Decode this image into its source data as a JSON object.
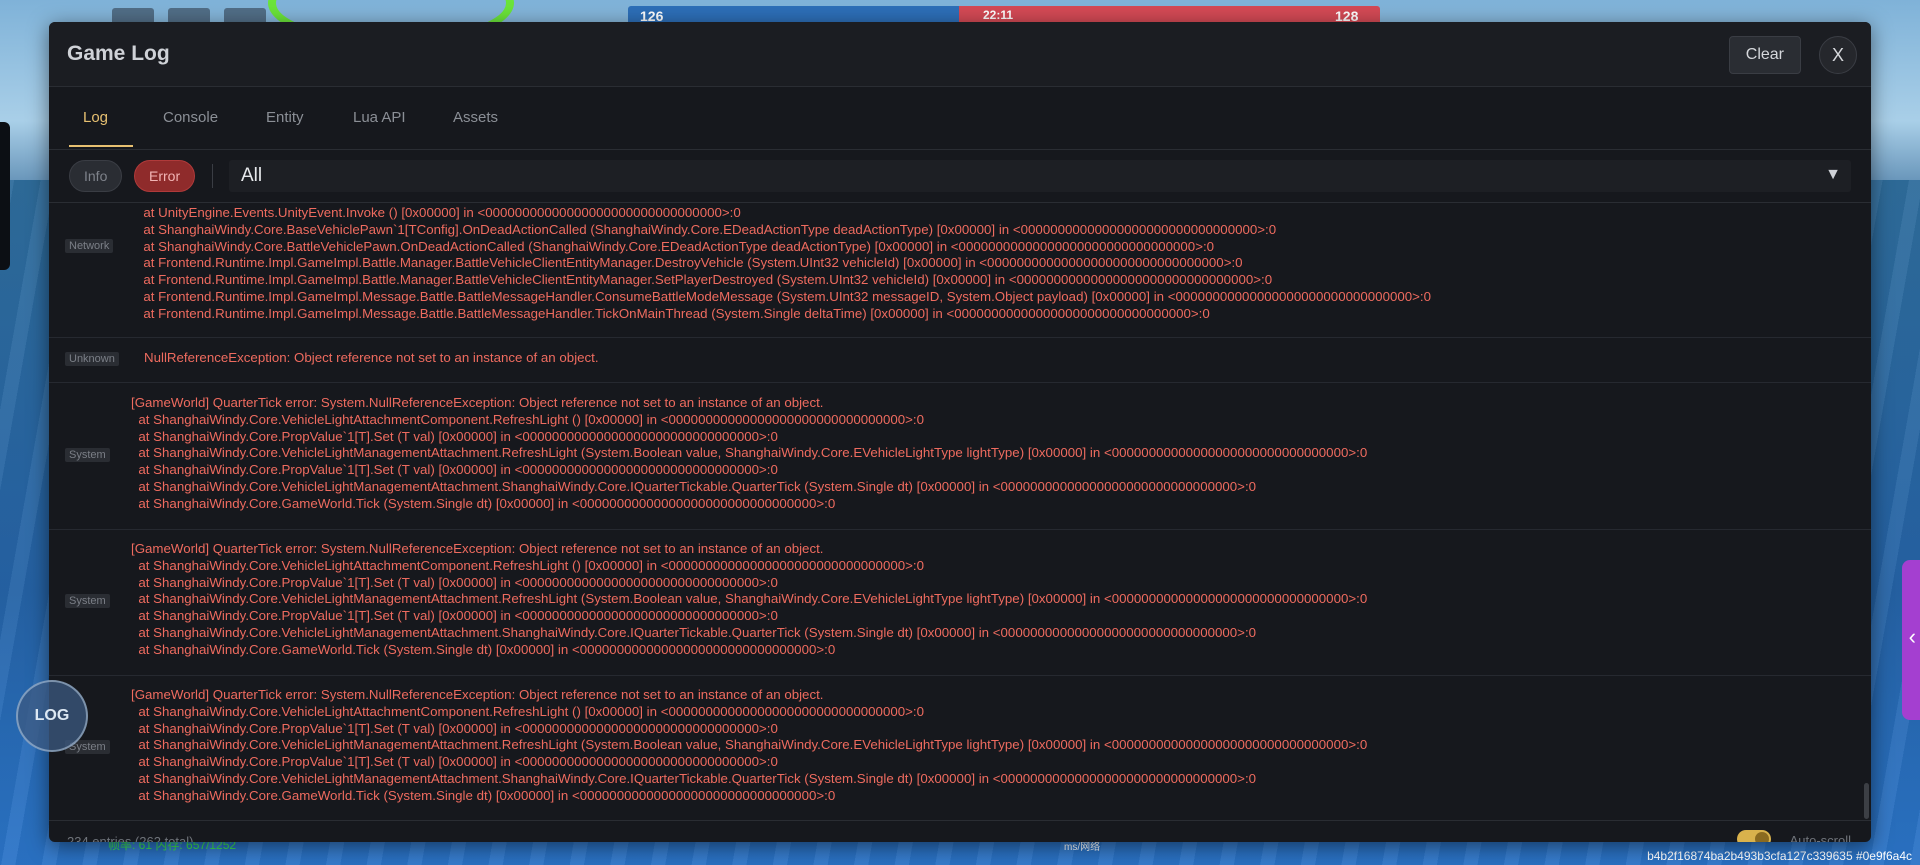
{
  "hud": {
    "score_left": "126",
    "score_right": "128",
    "clock": "22:11",
    "stats": "帧率: 61 内存: 657/1252",
    "ping": "ms/网络",
    "build_id": "b4b2f16874ba2b493b3cfa127c339635 #0e9f6a4c",
    "log_button": "LOG"
  },
  "panel": {
    "title": "Game Log",
    "clear_label": "Clear",
    "close_label": "X"
  },
  "tabs": [
    "Log",
    "Console",
    "Entity",
    "Lua API",
    "Assets"
  ],
  "filters": {
    "info_label": "Info",
    "error_label": "Error",
    "select_value": "All",
    "select_arrow": "▼"
  },
  "entries": [
    {
      "tag": "Network",
      "lines": "  at UnityEngine.Events.UnityEvent.Invoke () [0x00000] in <00000000000000000000000000000000>:0\n  at ShanghaiWindy.Core.BaseVehiclePawn`1[TConfig].OnDeadActionCalled (ShanghaiWindy.Core.EDeadActionType deadActionType) [0x00000] in <00000000000000000000000000000000>:0\n  at ShanghaiWindy.Core.BattleVehiclePawn.OnDeadActionCalled (ShanghaiWindy.Core.EDeadActionType deadActionType) [0x00000] in <00000000000000000000000000000000>:0\n  at Frontend.Runtime.Impl.GameImpl.Battle.Manager.BattleVehicleClientEntityManager.DestroyVehicle (System.UInt32 vehicleId) [0x00000] in <00000000000000000000000000000000>:0\n  at Frontend.Runtime.Impl.GameImpl.Battle.Manager.BattleVehicleClientEntityManager.SetPlayerDestroyed (System.UInt32 vehicleId) [0x00000] in <00000000000000000000000000000000>:0\n  at Frontend.Runtime.Impl.GameImpl.Message.Battle.BattleMessageHandler.ConsumeBattleModeMessage (System.UInt32 messageID, System.Object payload) [0x00000] in <00000000000000000000000000000000>:0\n  at Frontend.Runtime.Impl.GameImpl.Message.Battle.BattleMessageHandler.TickOnMainThread (System.Single deltaTime) [0x00000] in <00000000000000000000000000000000>:0"
    },
    {
      "tag": "Unknown",
      "lines": "NullReferenceException: Object reference not set to an instance of an object."
    },
    {
      "tag": "System",
      "lines": "[GameWorld] QuarterTick error: System.NullReferenceException: Object reference not set to an instance of an object.\n  at ShanghaiWindy.Core.VehicleLightAttachmentComponent.RefreshLight () [0x00000] in <00000000000000000000000000000000>:0\n  at ShanghaiWindy.Core.PropValue`1[T].Set (T val) [0x00000] in <00000000000000000000000000000000>:0\n  at ShanghaiWindy.Core.VehicleLightManagementAttachment.RefreshLight (System.Boolean value, ShanghaiWindy.Core.EVehicleLightType lightType) [0x00000] in <00000000000000000000000000000000>:0\n  at ShanghaiWindy.Core.PropValue`1[T].Set (T val) [0x00000] in <00000000000000000000000000000000>:0\n  at ShanghaiWindy.Core.VehicleLightManagementAttachment.ShanghaiWindy.Core.IQuarterTickable.QuarterTick (System.Single dt) [0x00000] in <00000000000000000000000000000000>:0\n  at ShanghaiWindy.Core.GameWorld.Tick (System.Single dt) [0x00000] in <00000000000000000000000000000000>:0"
    },
    {
      "tag": "System",
      "lines": "[GameWorld] QuarterTick error: System.NullReferenceException: Object reference not set to an instance of an object.\n  at ShanghaiWindy.Core.VehicleLightAttachmentComponent.RefreshLight () [0x00000] in <00000000000000000000000000000000>:0\n  at ShanghaiWindy.Core.PropValue`1[T].Set (T val) [0x00000] in <00000000000000000000000000000000>:0\n  at ShanghaiWindy.Core.VehicleLightManagementAttachment.RefreshLight (System.Boolean value, ShanghaiWindy.Core.EVehicleLightType lightType) [0x00000] in <00000000000000000000000000000000>:0\n  at ShanghaiWindy.Core.PropValue`1[T].Set (T val) [0x00000] in <00000000000000000000000000000000>:0\n  at ShanghaiWindy.Core.VehicleLightManagementAttachment.ShanghaiWindy.Core.IQuarterTickable.QuarterTick (System.Single dt) [0x00000] in <00000000000000000000000000000000>:0\n  at ShanghaiWindy.Core.GameWorld.Tick (System.Single dt) [0x00000] in <00000000000000000000000000000000>:0"
    },
    {
      "tag": "System",
      "lines": "[GameWorld] QuarterTick error: System.NullReferenceException: Object reference not set to an instance of an object.\n  at ShanghaiWindy.Core.VehicleLightAttachmentComponent.RefreshLight () [0x00000] in <00000000000000000000000000000000>:0\n  at ShanghaiWindy.Core.PropValue`1[T].Set (T val) [0x00000] in <00000000000000000000000000000000>:0\n  at ShanghaiWindy.Core.VehicleLightManagementAttachment.RefreshLight (System.Boolean value, ShanghaiWindy.Core.EVehicleLightType lightType) [0x00000] in <00000000000000000000000000000000>:0\n  at ShanghaiWindy.Core.PropValue`1[T].Set (T val) [0x00000] in <00000000000000000000000000000000>:0\n  at ShanghaiWindy.Core.VehicleLightManagementAttachment.ShanghaiWindy.Core.IQuarterTickable.QuarterTick (System.Single dt) [0x00000] in <00000000000000000000000000000000>:0\n  at ShanghaiWindy.Core.GameWorld.Tick (System.Single dt) [0x00000] in <00000000000000000000000000000000>:0"
    }
  ],
  "footer": {
    "count": "234 entries (262 total)",
    "autoscroll_label": "Auto-scroll",
    "autoscroll_on": true
  },
  "colors": {
    "accent": "#e7c071",
    "error_text": "#ee6b5f",
    "error_chip": "#8f2b2b",
    "panel_bg": "#16181d"
  }
}
